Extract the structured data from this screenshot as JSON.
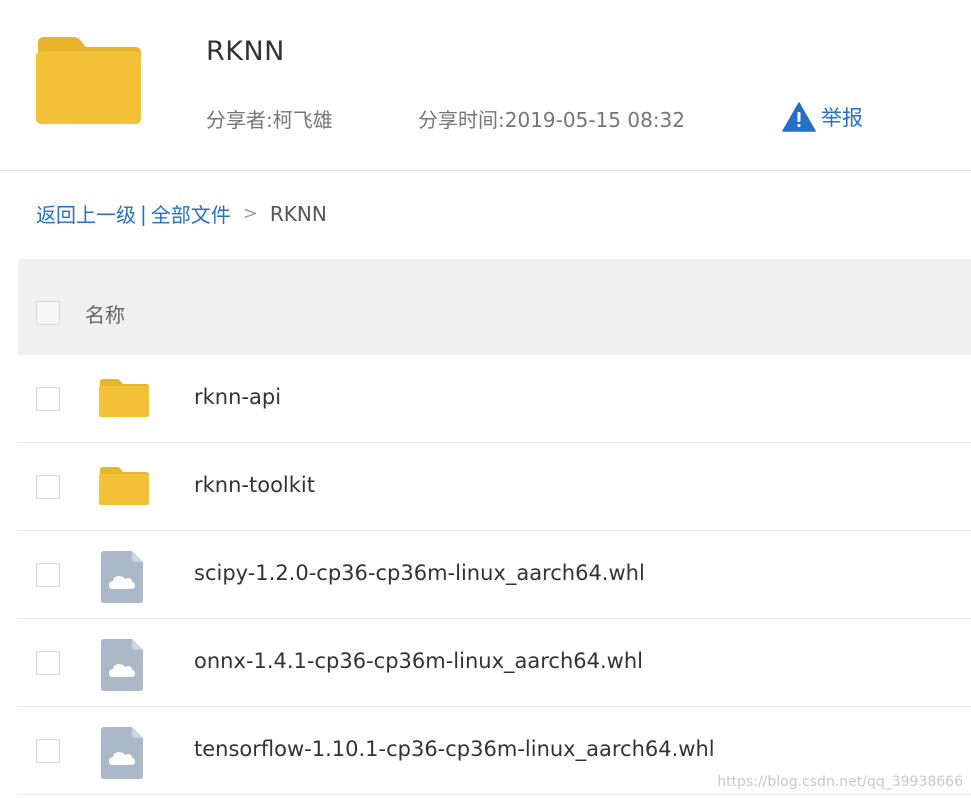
{
  "header": {
    "title": "RKNN",
    "sharer_label": "分享者:",
    "sharer_name": "柯飞雄",
    "time_label": "分享时间:",
    "time_value": "2019-05-15 08:32",
    "report_label": "举报"
  },
  "breadcrumb": {
    "back": "返回上一级",
    "separator": "|",
    "all_files": "全部文件",
    "arrow": ">",
    "current": "RKNN"
  },
  "list": {
    "column_name": "名称",
    "rows": [
      {
        "name": "rknn-api",
        "type": "folder"
      },
      {
        "name": "rknn-toolkit",
        "type": "folder"
      },
      {
        "name": "scipy-1.2.0-cp36-cp36m-linux_aarch64.whl",
        "type": "file"
      },
      {
        "name": "onnx-1.4.1-cp36-cp36m-linux_aarch64.whl",
        "type": "file"
      },
      {
        "name": "tensorflow-1.10.1-cp36-cp36m-linux_aarch64.whl",
        "type": "file"
      }
    ]
  },
  "watermark": "https://blog.csdn.net/qq_39938666",
  "colors": {
    "folder": "#f3c138",
    "folder_tab": "#e8b42c",
    "link": "#2570c9",
    "file_icon": "#aab8c7"
  },
  "icons": {
    "header": "folder-icon",
    "report": "warning-icon",
    "folder_row": "folder-icon",
    "file_row": "cloud-file-icon"
  }
}
